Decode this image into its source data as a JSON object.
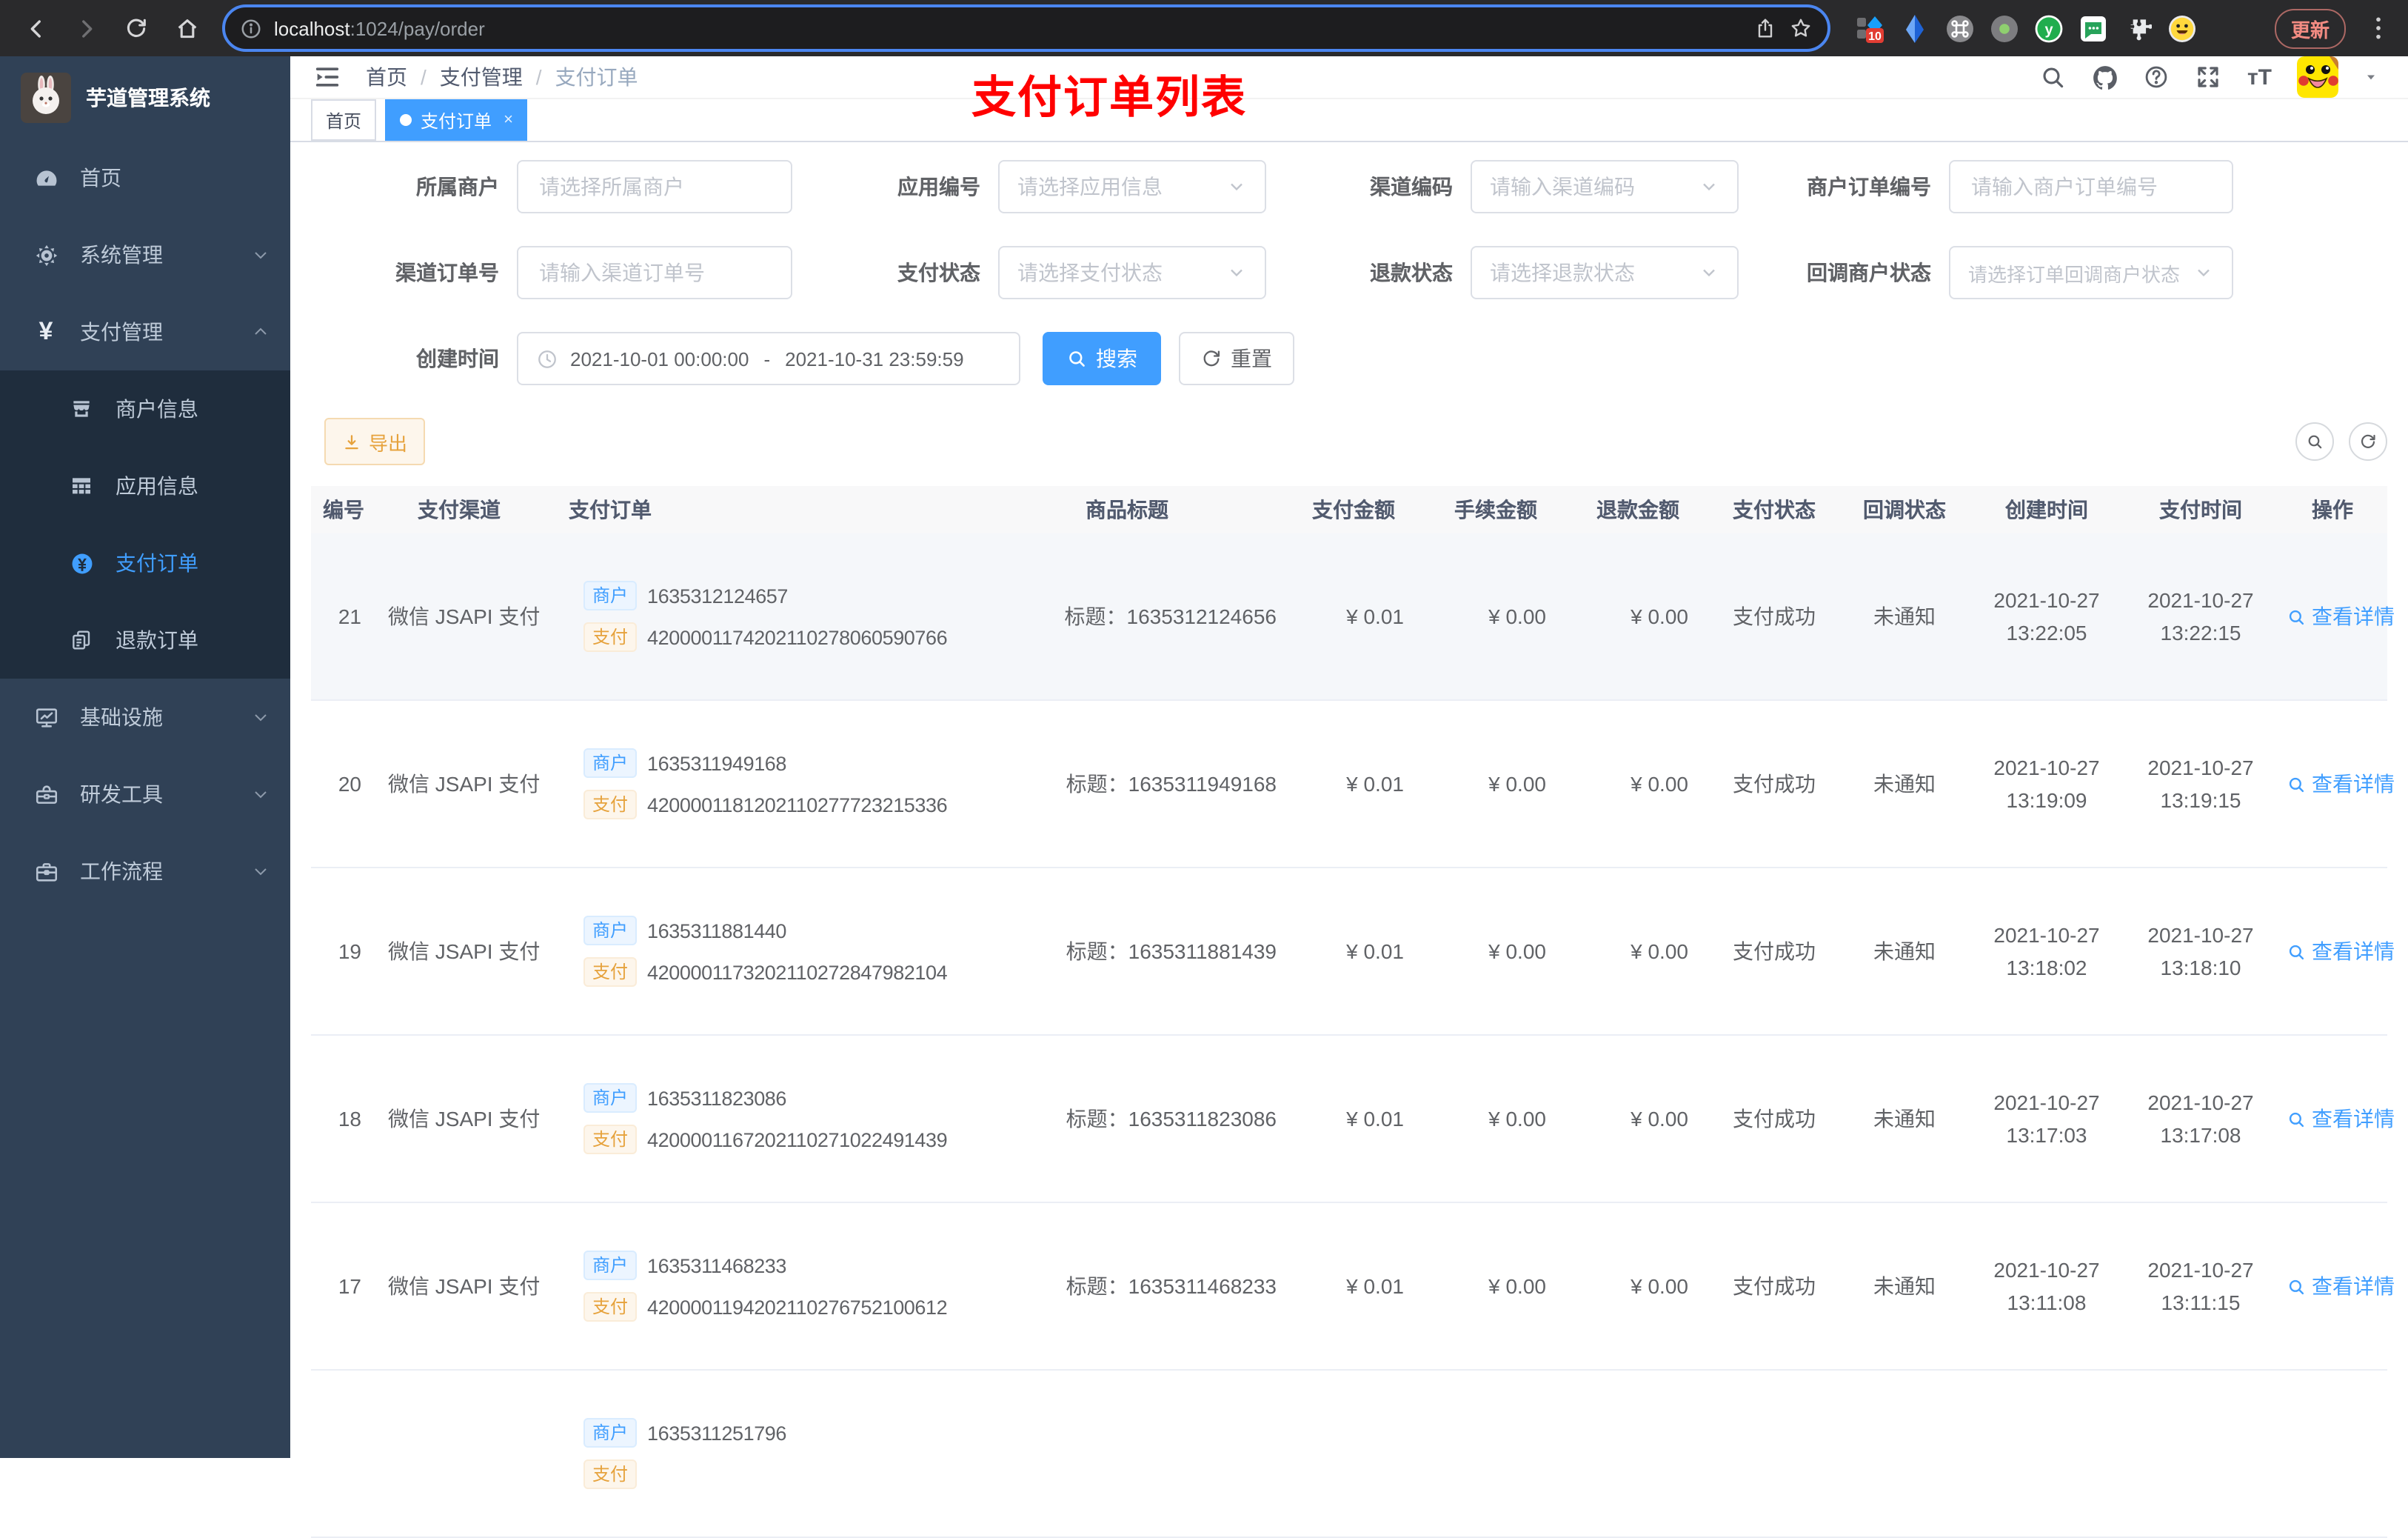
{
  "theme": {
    "primary": "#409eff",
    "sidebar_bg": "#304156",
    "submenu_bg": "#1f2d3d",
    "annotation_red": "#ff0000",
    "warning": "#e6a23c",
    "url_focus_ring": "#4b86f0"
  },
  "browser": {
    "url_host": "localhost",
    "url_rest": ":1024/pay/order",
    "ext_badge": "10",
    "update_label": "更新"
  },
  "sidebar": {
    "title": "芋道管理系统",
    "items": {
      "home": "首页",
      "system": "系统管理",
      "pay": "支付管理",
      "merchant": "商户信息",
      "app": "应用信息",
      "order": "支付订单",
      "refund": "退款订单",
      "infra": "基础设施",
      "devtools": "研发工具",
      "workflow": "工作流程"
    }
  },
  "navbar": {
    "breadcrumb": [
      "首页",
      "支付管理",
      "支付订单"
    ],
    "annotation": "支付订单列表"
  },
  "tabs": {
    "home": "首页",
    "active": "支付订单",
    "close": "×"
  },
  "filters": {
    "merchant": {
      "label": "所属商户",
      "placeholder": "请选择所属商户"
    },
    "app": {
      "label": "应用编号",
      "placeholder": "请选择应用信息"
    },
    "channel_code": {
      "label": "渠道编码",
      "placeholder": "请输入渠道编码"
    },
    "mch_order_no": {
      "label": "商户订单编号",
      "placeholder": "请输入商户订单编号"
    },
    "channel_order_no": {
      "label": "渠道订单号",
      "placeholder": "请输入渠道订单号"
    },
    "pay_status": {
      "label": "支付状态",
      "placeholder": "请选择支付状态"
    },
    "refund_status": {
      "label": "退款状态",
      "placeholder": "请选择退款状态"
    },
    "notify_status": {
      "label": "回调商户状态",
      "placeholder": "请选择订单回调商户状态"
    },
    "create_time": {
      "label": "创建时间",
      "start": "2021-10-01 00:00:00",
      "separator": "-",
      "end": "2021-10-31 23:59:59"
    },
    "search_label": "搜索",
    "reset_label": "重置"
  },
  "toolbar": {
    "export_label": "导出"
  },
  "table": {
    "columns": [
      "编号",
      "支付渠道",
      "支付订单",
      "商品标题",
      "支付金额",
      "手续金额",
      "退款金额",
      "支付状态",
      "回调状态",
      "创建时间",
      "支付时间",
      "操作"
    ],
    "tag_merchant": "商户",
    "tag_pay": "支付",
    "action_label": "查看详情",
    "rows": [
      {
        "id": "21",
        "channel": "微信 JSAPI 支付",
        "mch_no": "1635312124657",
        "pay_no": "4200001174202110278060590766",
        "title": "标题：1635312124656",
        "amount": "¥ 0.01",
        "fee": "¥ 0.00",
        "refund": "¥ 0.00",
        "status": "支付成功",
        "notify": "未通知",
        "create_date": "2021-10-27",
        "create_time": "13:22:05",
        "pay_date": "2021-10-27",
        "pay_time": "13:22:15"
      },
      {
        "id": "20",
        "channel": "微信 JSAPI 支付",
        "mch_no": "1635311949168",
        "pay_no": "4200001181202110277723215336",
        "title": "标题：1635311949168",
        "amount": "¥ 0.01",
        "fee": "¥ 0.00",
        "refund": "¥ 0.00",
        "status": "支付成功",
        "notify": "未通知",
        "create_date": "2021-10-27",
        "create_time": "13:19:09",
        "pay_date": "2021-10-27",
        "pay_time": "13:19:15"
      },
      {
        "id": "19",
        "channel": "微信 JSAPI 支付",
        "mch_no": "1635311881440",
        "pay_no": "4200001173202110272847982104",
        "title": "标题：1635311881439",
        "amount": "¥ 0.01",
        "fee": "¥ 0.00",
        "refund": "¥ 0.00",
        "status": "支付成功",
        "notify": "未通知",
        "create_date": "2021-10-27",
        "create_time": "13:18:02",
        "pay_date": "2021-10-27",
        "pay_time": "13:18:10"
      },
      {
        "id": "18",
        "channel": "微信 JSAPI 支付",
        "mch_no": "1635311823086",
        "pay_no": "4200001167202110271022491439",
        "title": "标题：1635311823086",
        "amount": "¥ 0.01",
        "fee": "¥ 0.00",
        "refund": "¥ 0.00",
        "status": "支付成功",
        "notify": "未通知",
        "create_date": "2021-10-27",
        "create_time": "13:17:03",
        "pay_date": "2021-10-27",
        "pay_time": "13:17:08"
      },
      {
        "id": "17",
        "channel": "微信 JSAPI 支付",
        "mch_no": "1635311468233",
        "pay_no": "4200001194202110276752100612",
        "title": "标题：1635311468233",
        "amount": "¥ 0.01",
        "fee": "¥ 0.00",
        "refund": "¥ 0.00",
        "status": "支付成功",
        "notify": "未通知",
        "create_date": "2021-10-27",
        "create_time": "13:11:08",
        "pay_date": "2021-10-27",
        "pay_time": "13:11:15"
      }
    ],
    "partial_row": {
      "mch_no": "1635311251796"
    }
  }
}
